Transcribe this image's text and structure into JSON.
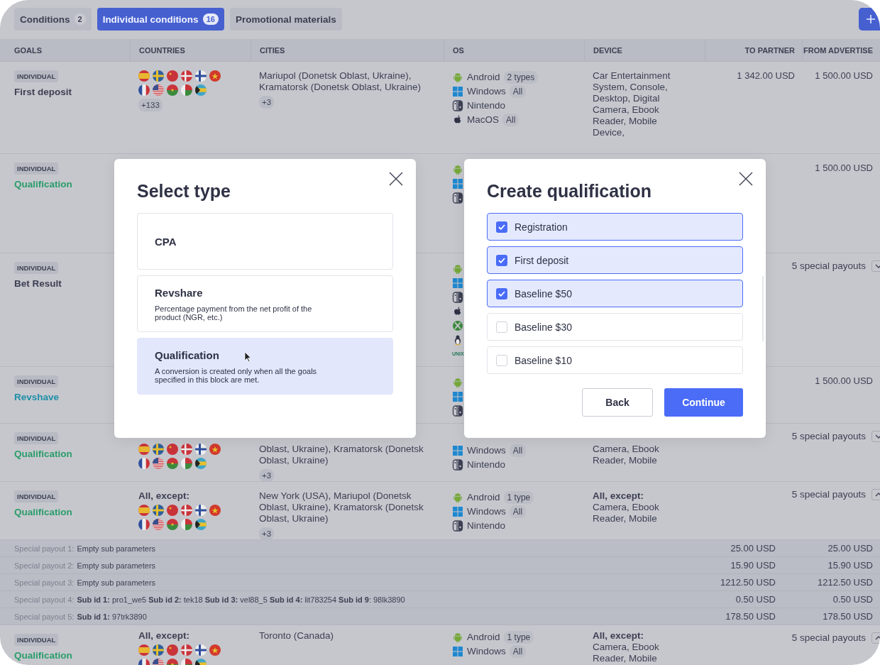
{
  "tabs": [
    {
      "label": "Conditions",
      "count": "2",
      "selected": false
    },
    {
      "label": "Individual conditions",
      "count": "16",
      "selected": true
    },
    {
      "label": "Promotional materials",
      "selected": false
    }
  ],
  "table": {
    "columns": [
      "GOALS",
      "COUNTRIES",
      "CITIES",
      "OS",
      "DEVICE",
      "TO PARTNER",
      "FROM ADVERTISE"
    ],
    "rows": [
      {
        "goal": {
          "badge": "INDIVIDUAL",
          "name": "First deposit",
          "color": "#3d4053"
        },
        "countries": {
          "more": "+133"
        },
        "cities": {
          "text": "Mariupol (Donetsk Oblast, Ukraine), Kramatorsk (Donetsk Oblast, Ukraine)",
          "more": "+3"
        },
        "os": [
          {
            "kind": "android",
            "name": "Android",
            "tag": "2 types"
          },
          {
            "kind": "windows",
            "name": "Windows",
            "tag": "All"
          },
          {
            "kind": "nintendo",
            "name": "Nintendo"
          },
          {
            "kind": "apple",
            "name": "MacOS",
            "tag": "All"
          }
        ],
        "device": {
          "text": "Car Entertainment System, Console, Desktop, Digital Camera, Ebook Reader, Mobile Device,"
        },
        "to_partner": "1 342.00 USD",
        "from_advertiser": "1 500.00 USD"
      },
      {
        "goal": {
          "badge": "INDIVIDUAL",
          "name": "Qualification",
          "color": "#2a9d6a"
        },
        "os": [
          {
            "kind": "android"
          },
          {
            "kind": "windows"
          },
          {
            "kind": "nintendo"
          }
        ],
        "from_advertiser": "1 500.00 USD"
      },
      {
        "goal": {
          "badge": "INDIVIDUAL",
          "name": "Bet Result",
          "color": "#3d4053"
        },
        "os": [
          {
            "kind": "android"
          },
          {
            "kind": "windows"
          },
          {
            "kind": "nintendo"
          },
          {
            "kind": "apple"
          },
          {
            "kind": "xbox"
          },
          {
            "kind": "linux"
          },
          {
            "kind": "unix",
            "name": "UNIX"
          }
        ],
        "payouts": {
          "label": "5 special payouts",
          "expanded": false
        }
      },
      {
        "goal": {
          "badge": "INDIVIDUAL",
          "name": "Revshave",
          "color": "#1f8fa8"
        },
        "os": [
          {
            "kind": "android"
          },
          {
            "kind": "windows"
          },
          {
            "kind": "nintendo"
          }
        ],
        "from_advertiser": "1 500.00 USD"
      },
      {
        "goal": {
          "badge": "INDIVIDUAL",
          "name": "Qualification",
          "color": "#2a9d6a"
        },
        "countries": {},
        "cities": {
          "text": "Oblast, Ukraine), Kramatorsk (Donetsk Oblast, Ukraine)",
          "more": "+3"
        },
        "os": [
          {
            "kind": "windows",
            "name": "Windows",
            "tag": "All"
          },
          {
            "kind": "nintendo",
            "name": "Nintendo"
          }
        ],
        "device": {
          "text": "Camera, Ebook Reader, Mobile"
        },
        "payouts": {
          "label": "5 special payouts",
          "expanded": false
        }
      },
      {
        "goal": {
          "badge": "INDIVIDUAL",
          "name": "Qualification",
          "color": "#2a9d6a"
        },
        "countries": {
          "heading": "All, except:"
        },
        "cities": {
          "text": "New York (USA), Mariupol (Donetsk Oblast, Ukraine), Kramatorsk (Donetsk Oblast, Ukraine)",
          "more": "+3"
        },
        "os": [
          {
            "kind": "android",
            "name": "Android",
            "tag": "1 type"
          },
          {
            "kind": "windows",
            "name": "Windows",
            "tag": "All"
          },
          {
            "kind": "nintendo",
            "name": "Nintendo"
          }
        ],
        "device": {
          "heading": "All, except:",
          "text": "Camera, Ebook Reader, Mobile"
        },
        "payouts": {
          "label": "5 special payouts",
          "expanded": true
        },
        "special": [
          {
            "label": "Special payout 1:",
            "value": "Empty sub parameters",
            "to_partner": "25.00 USD",
            "from_advertiser": "25.00 USD"
          },
          {
            "label": "Special payout 2:",
            "value": "Empty sub parameters",
            "to_partner": "15.90 USD",
            "from_advertiser": "15.90 USD"
          },
          {
            "label": "Special payout 3:",
            "value": "Empty sub parameters",
            "to_partner": "1212.50 USD",
            "from_advertiser": "1212.50 USD"
          },
          {
            "label": "Special payout 4:",
            "value": "**Sub id 1:** pro1_we5  **Sub id 2:** tek18 **Sub id 3:** vel88_5 **Sub id 4:** lit783254 **Sub id 9**: 98lk3890",
            "to_partner": "0.50 USD",
            "from_advertiser": "0.50 USD"
          },
          {
            "label": "Special payout 5:",
            "value": "**Sub id 1:** 97trk3890",
            "to_partner": "178.50 USD",
            "from_advertiser": "178.50 USD"
          }
        ]
      },
      {
        "goal": {
          "badge": "INDIVIDUAL",
          "name": "Qualification",
          "color": "#2a9d6a"
        },
        "countries": {
          "heading": "All, except:"
        },
        "cities": {
          "text": "Toronto (Canada)"
        },
        "os": [
          {
            "kind": "android",
            "name": "Android",
            "tag": "1 type"
          },
          {
            "kind": "windows",
            "name": "Windows",
            "tag": "All"
          }
        ],
        "device": {
          "heading": "All, except:",
          "text": "Camera, Ebook Reader, Mobile"
        },
        "payouts": {
          "label": "5 special payouts",
          "expanded": true
        }
      }
    ]
  },
  "select_type": {
    "title": "Select type",
    "options": [
      {
        "title": "CPA",
        "selected": false
      },
      {
        "title": "Revshare",
        "description": "Percentage payment from the net profit of the product (NGR, etc.)",
        "selected": false
      },
      {
        "title": "Qualification",
        "description": "A conversion is created only when all the goals specified in this block are met.",
        "selected": true
      }
    ]
  },
  "create_qualification": {
    "title": "Create qualification",
    "items": [
      {
        "label": "Registration",
        "checked": true
      },
      {
        "label": "First deposit",
        "checked": true
      },
      {
        "label": "Baseline $50",
        "checked": true
      },
      {
        "label": "Baseline $30",
        "checked": false
      },
      {
        "label": "Baseline $10",
        "checked": false
      }
    ],
    "buttons": {
      "back": "Back",
      "continue": "Continue"
    }
  }
}
